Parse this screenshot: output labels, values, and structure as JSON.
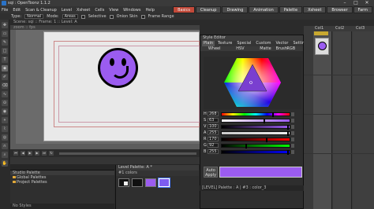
{
  "app": {
    "title": "sqi : OpenToonz 1.1.2"
  },
  "window_controls": [
    "–",
    "□",
    "✕"
  ],
  "menu": [
    "File",
    "Edit",
    "Scan & Cleanup",
    "Level",
    "Xsheet",
    "Cells",
    "View",
    "Windows",
    "Help"
  ],
  "rooms": [
    {
      "label": "Basics",
      "active": true
    },
    {
      "label": "Cleanup",
      "active": false
    },
    {
      "label": "Drawing",
      "active": false
    },
    {
      "label": "Animation",
      "active": false
    },
    {
      "label": "Palette",
      "active": false
    },
    {
      "label": "Xsheet",
      "active": false
    },
    {
      "label": "Browser",
      "active": false
    },
    {
      "label": "Farm",
      "active": false
    }
  ],
  "tool_options": {
    "type_label": "Type:",
    "type_value": "Normal",
    "mode_label": "Mode:",
    "mode_value": "Areas",
    "selective": "Selective",
    "onion": "Onion Skin",
    "frame_range": "Frame Range"
  },
  "viewer": {
    "header": "Scene: sqi  ::  Frame: 1  ::  Level: A",
    "sub": "zoom  ::  fps"
  },
  "scene_cast": {
    "header": "Studio Palette",
    "items": [
      "Global Palettes",
      "Project Palettes"
    ],
    "footer": "No Styles"
  },
  "level_palette": {
    "header": "Level Palette: A *",
    "toolbar": "#1  colors",
    "colors": [
      "#101010",
      "#ffffff",
      "#9b5cf0",
      "#7d5cf0"
    ]
  },
  "style_editor": {
    "header": "Style Editor",
    "tabs": [
      "Plain",
      "Texture",
      "Special",
      "Custom",
      "Vector Brush",
      "Settings"
    ],
    "subtabs": [
      "Wheel",
      "HSV",
      "Matte",
      "RGB"
    ],
    "sliders": [
      {
        "label": "H",
        "value": "268"
      },
      {
        "label": "S",
        "value": "63"
      },
      {
        "label": "V",
        "value": "100"
      },
      {
        "label": "A",
        "value": "255"
      },
      {
        "label": "R",
        "value": "170"
      },
      {
        "label": "G",
        "value": "92"
      },
      {
        "label": "B",
        "value": "255"
      }
    ],
    "auto_apply": "Auto",
    "apply": "Apply",
    "footer": "[LEVEL]  Palette : A  |  #3 : color_3",
    "current_color": "#9b5cf0"
  },
  "xsheet": {
    "columns": [
      "Col1",
      "Col2",
      "Col3"
    ]
  }
}
